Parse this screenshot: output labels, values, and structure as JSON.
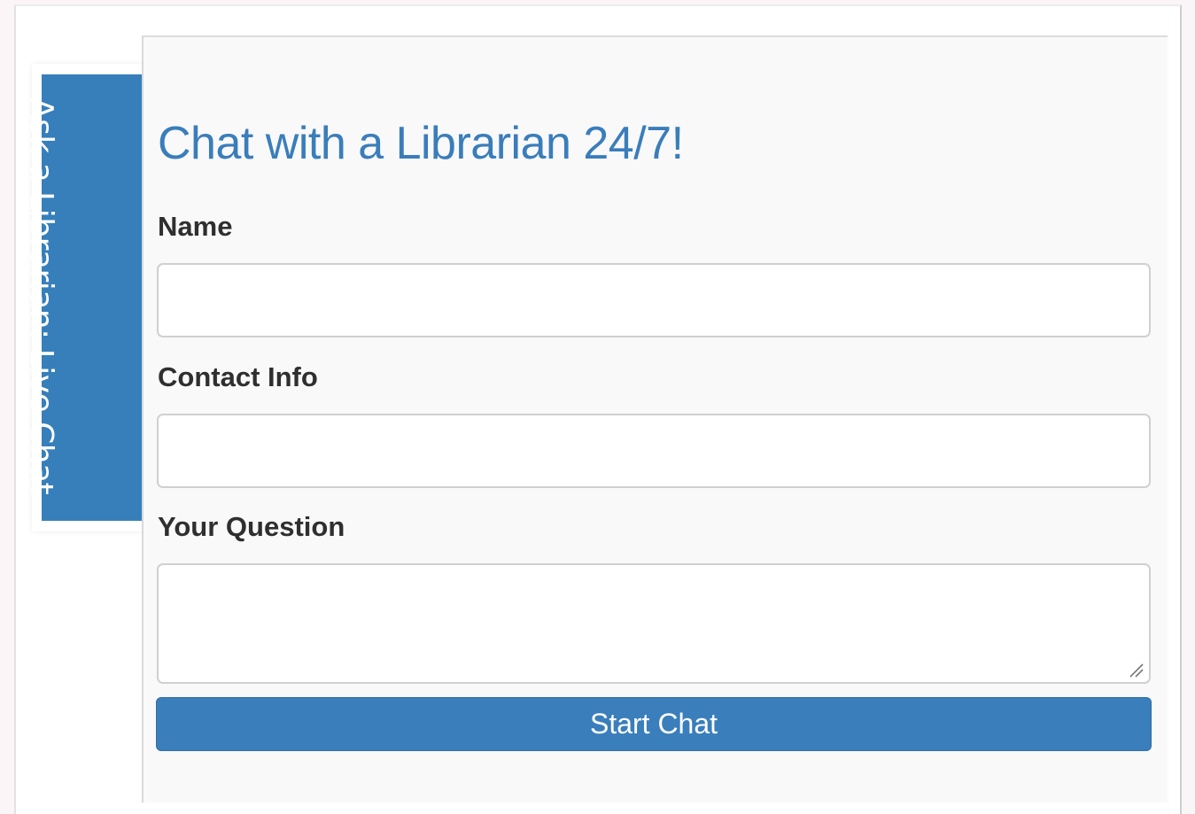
{
  "tab": {
    "label": "Ask a Librarian: Live Chat"
  },
  "form": {
    "title": "Chat with a Librarian 24/7!",
    "name_label": "Name",
    "name_value": "",
    "contact_label": "Contact Info",
    "contact_value": "",
    "question_label": "Your Question",
    "question_value": "",
    "submit_label": "Start Chat"
  },
  "colors": {
    "accent": "#3a7ebb",
    "panel_bg": "#f9f9f9",
    "label_text": "#2f2f2f"
  }
}
